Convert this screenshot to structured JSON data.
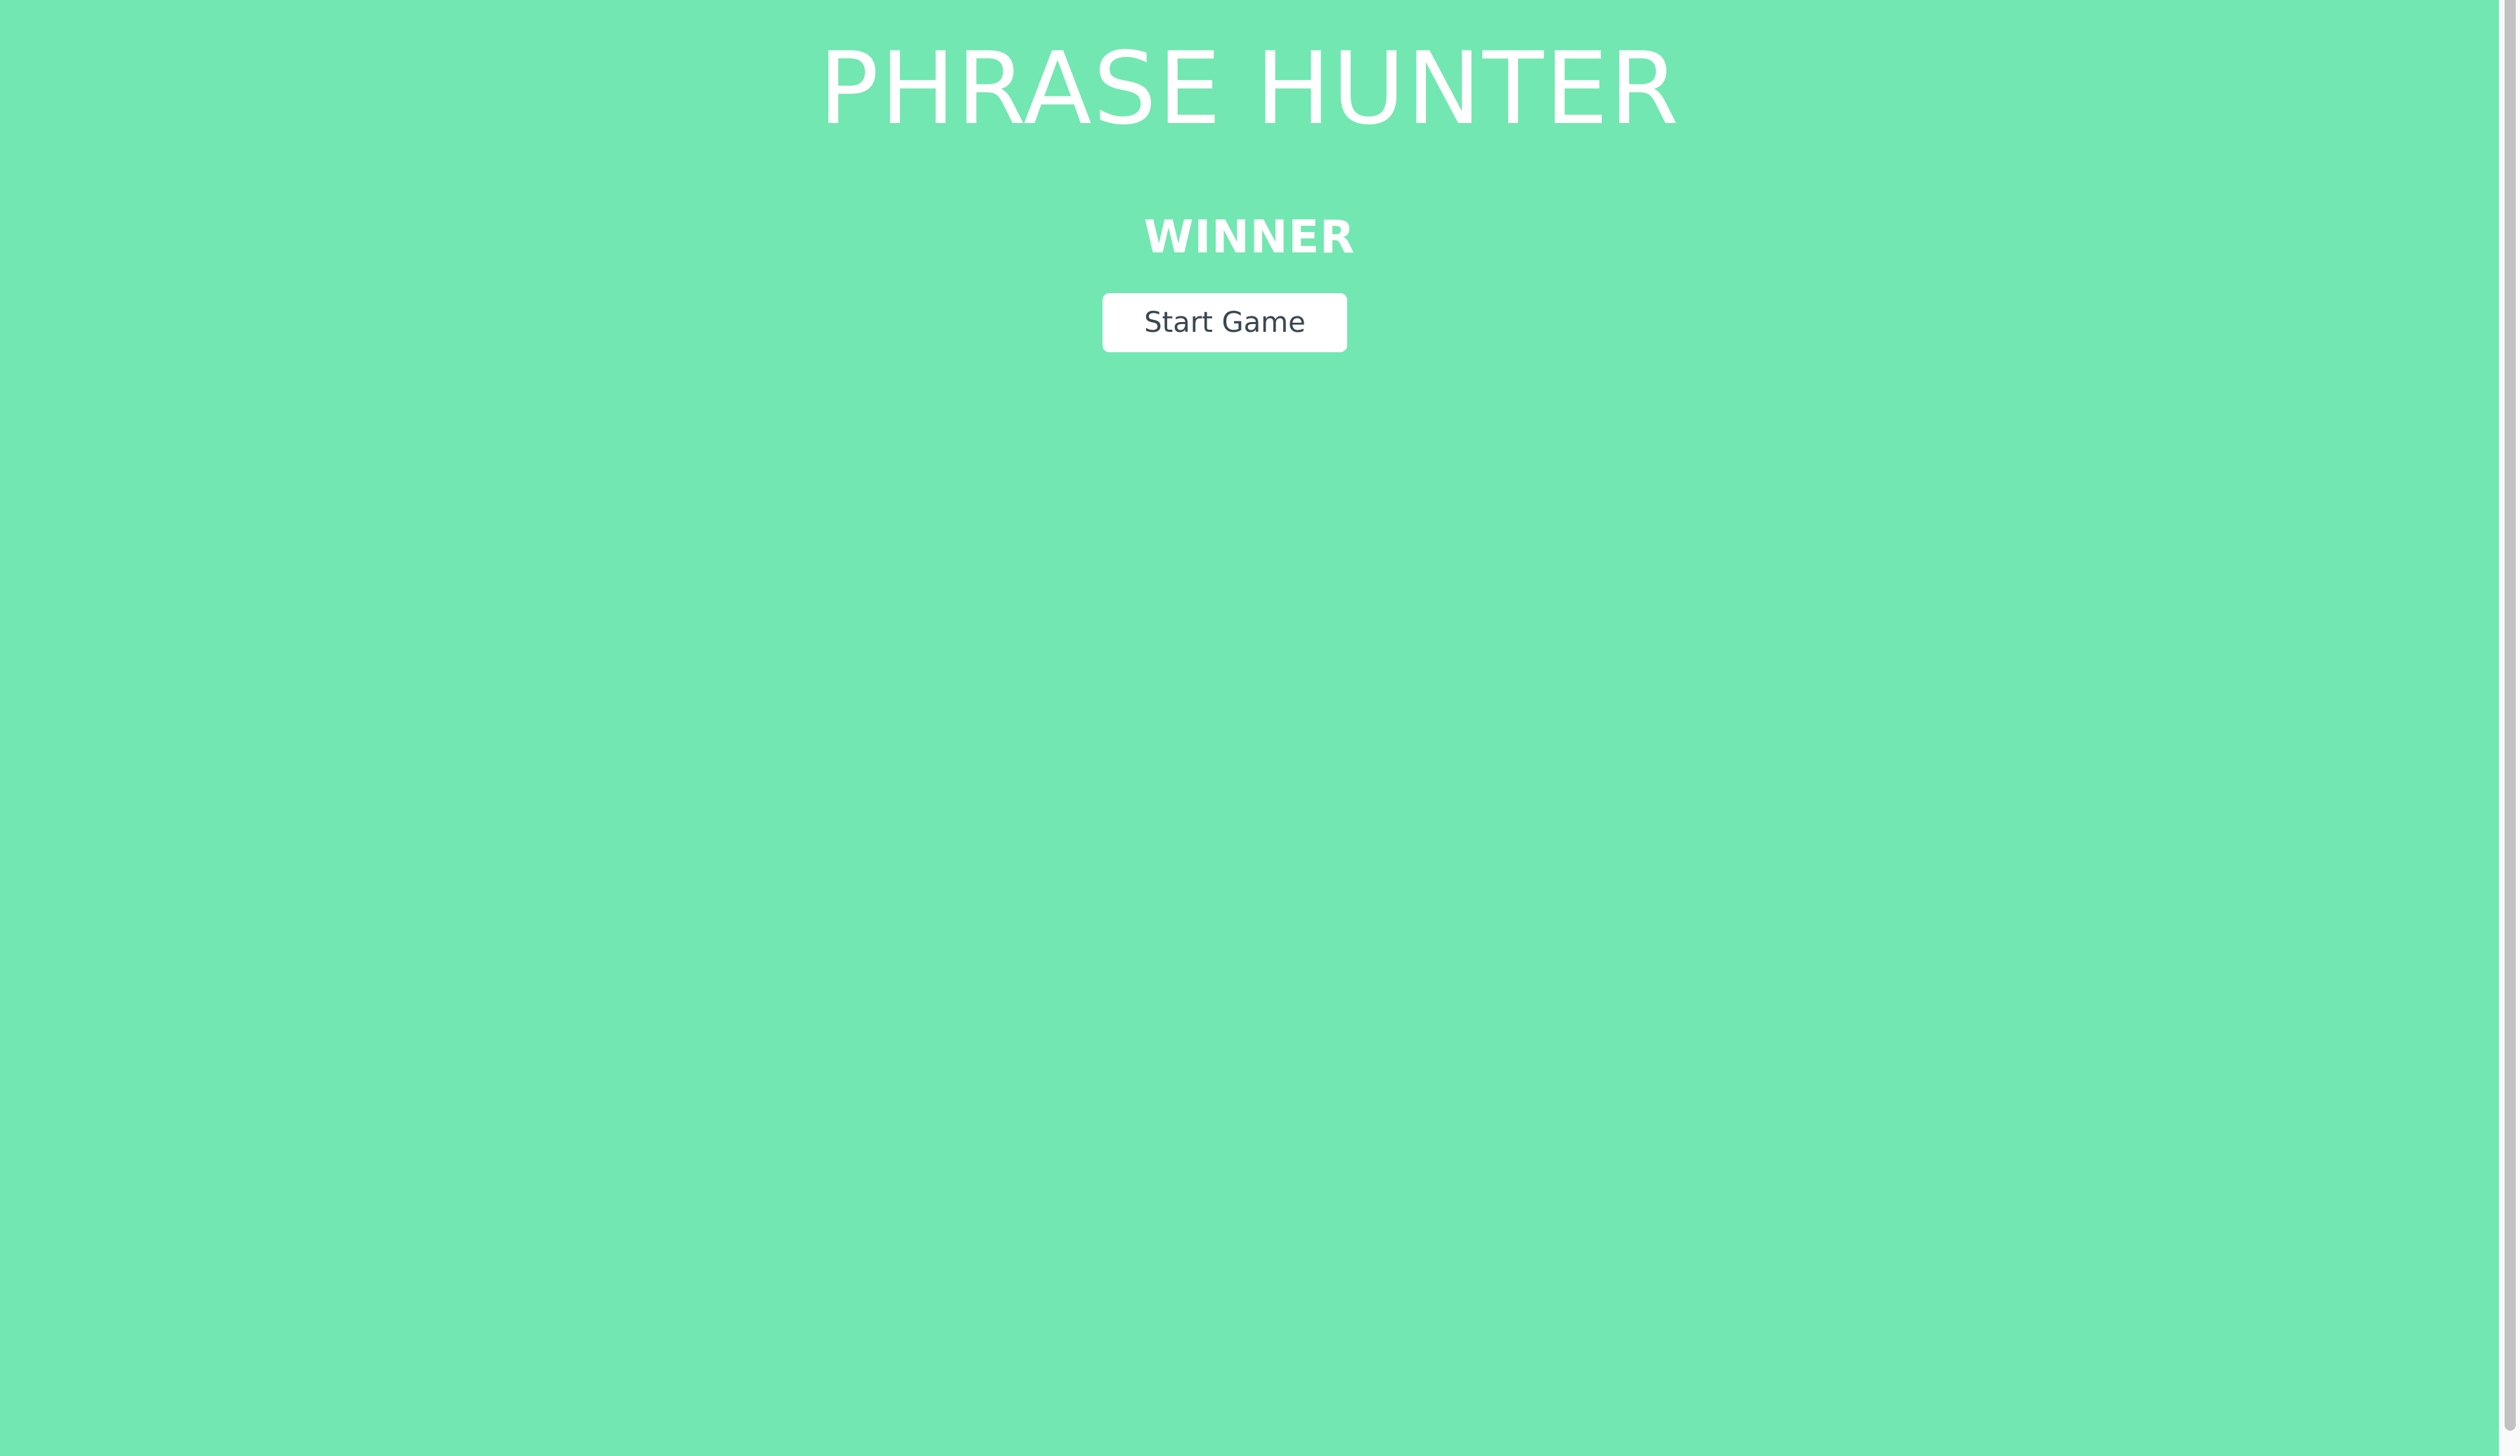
{
  "game": {
    "title": "PHRASE HUNTER",
    "result_message": "WINNER",
    "start_button_label": "Start Game"
  },
  "colors": {
    "background": "#72e7b1",
    "button_text": "#3a4750",
    "title_text": "#ffffff"
  }
}
